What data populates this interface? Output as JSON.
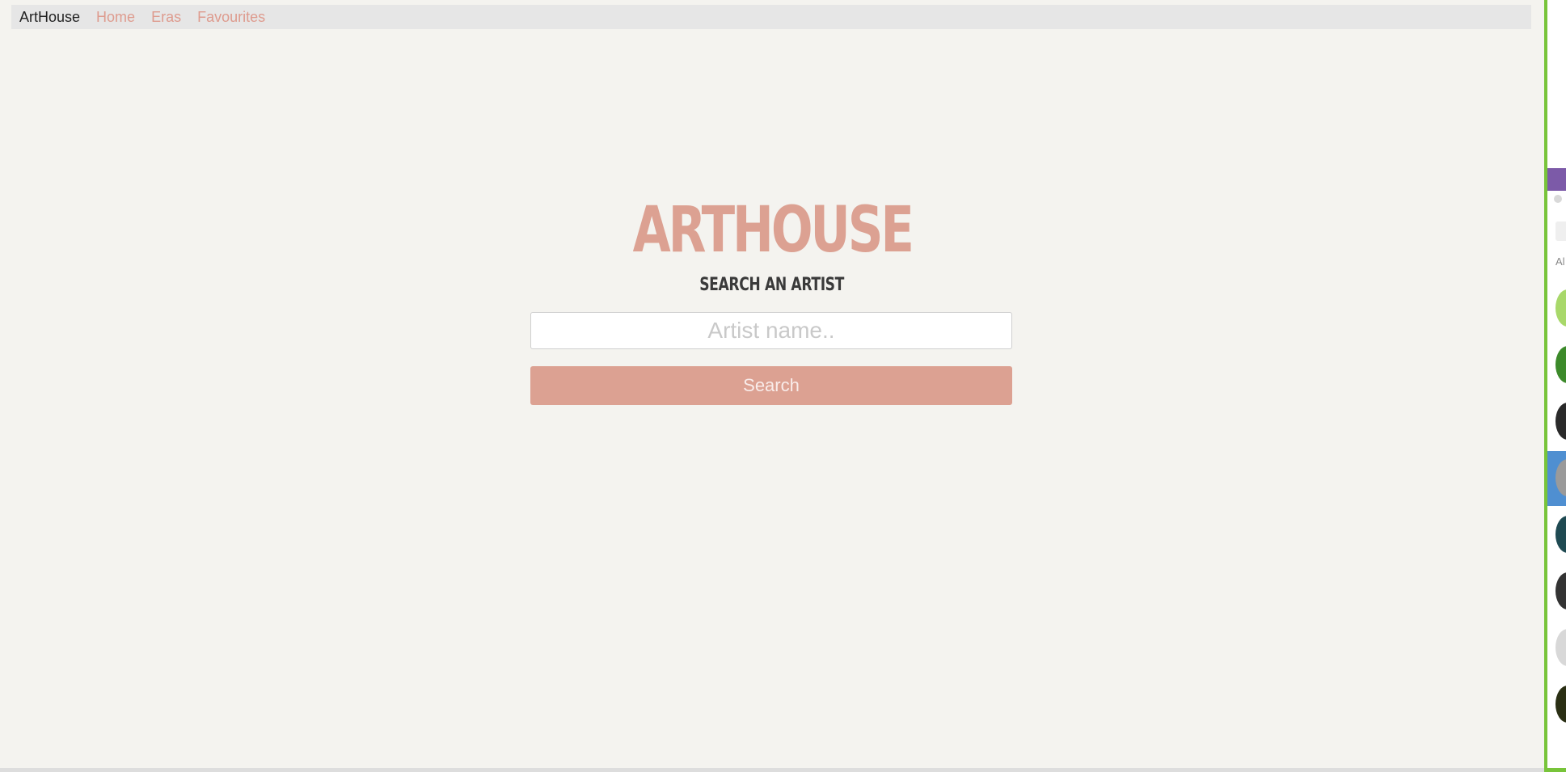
{
  "navbar": {
    "brand": "ArtHouse",
    "links": [
      "Home",
      "Eras",
      "Favourites"
    ]
  },
  "hero": {
    "title": "ARTHOUSE",
    "subtitle": "SEARCH AN ARTIST"
  },
  "search": {
    "placeholder": "Artist name..",
    "value": "",
    "button_label": "Search"
  },
  "side_window": {
    "visible_text": "Al"
  },
  "colors": {
    "accent": "#dca192",
    "nav_link": "#de9b8e",
    "page_background": "#f4f3ef",
    "navbar_background": "#e6e6e6",
    "side_border": "#78c43a",
    "side_selected": "#4f8fd1",
    "side_header": "#7c5aa8"
  }
}
